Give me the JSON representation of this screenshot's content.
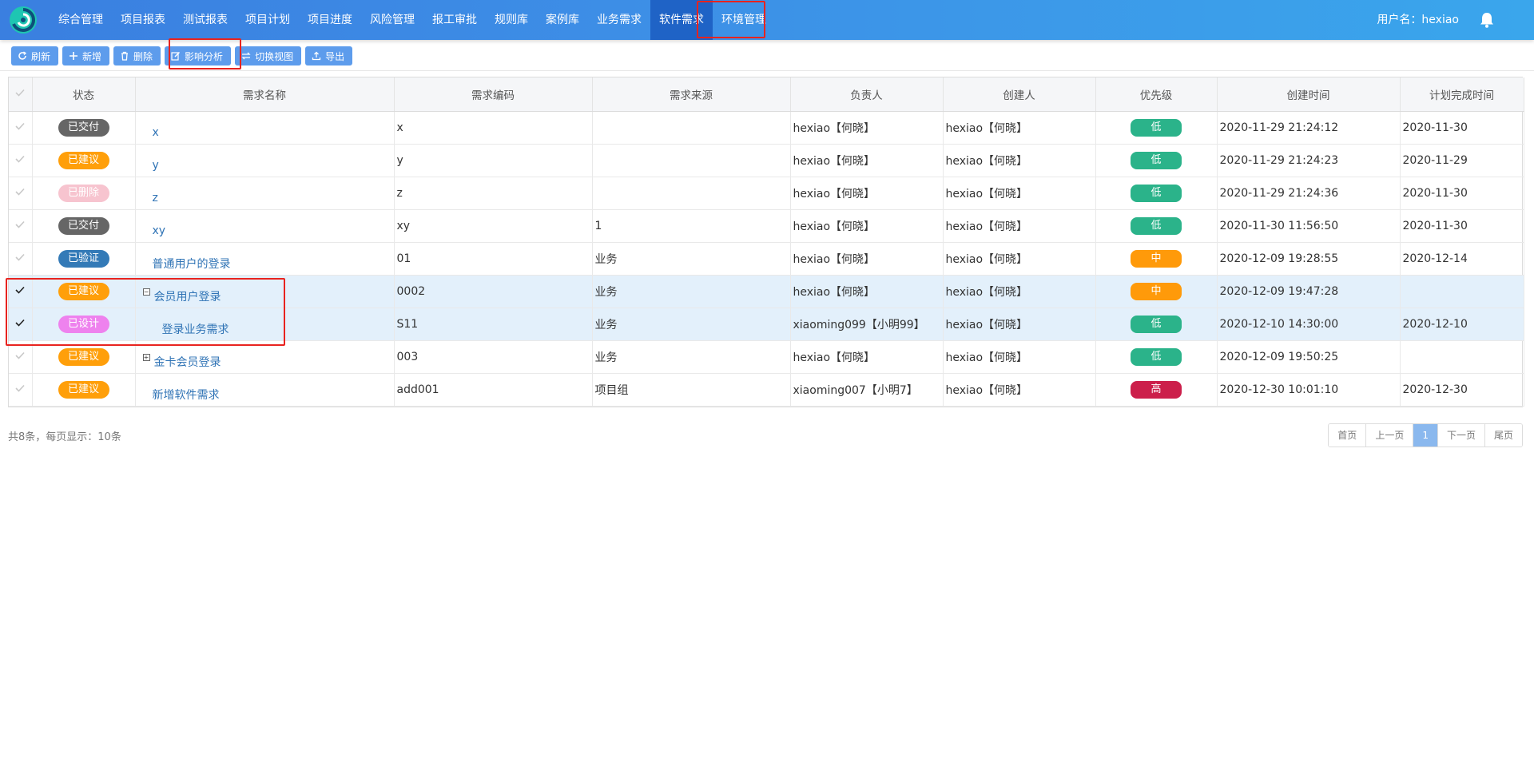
{
  "nav": {
    "items": [
      "综合管理",
      "项目报表",
      "测试报表",
      "项目计划",
      "项目进度",
      "风险管理",
      "报工审批",
      "规则库",
      "案例库",
      "业务需求",
      "软件需求",
      "环境管理"
    ],
    "active_index": 10,
    "user_label": "用户名：hexiao",
    "logo_icon": "swirl-logo-icon",
    "bell_icon": "bell-icon"
  },
  "toolbar": {
    "refresh": "刷新",
    "add": "新增",
    "delete": "删除",
    "impact": "影响分析",
    "switch_view": "切换视图",
    "export": "导出"
  },
  "table": {
    "headers": {
      "status": "状态",
      "name": "需求名称",
      "code": "需求编码",
      "source": "需求来源",
      "owner": "负责人",
      "creator": "创建人",
      "priority": "优先级",
      "created": "创建时间",
      "due": "计划完成时间"
    },
    "rows": [
      {
        "status": "已交付",
        "name": "x",
        "code": "x",
        "source": "",
        "owner": "hexiao【何晓】",
        "creator": "hexiao【何晓】",
        "priority": "低",
        "created": "2020-11-29 21:24:12",
        "due": "2020-11-30"
      },
      {
        "status": "已建议",
        "name": "y",
        "code": "y",
        "source": "",
        "owner": "hexiao【何晓】",
        "creator": "hexiao【何晓】",
        "priority": "低",
        "created": "2020-11-29 21:24:23",
        "due": "2020-11-29"
      },
      {
        "status": "已删除",
        "name": "z",
        "code": "z",
        "source": "",
        "owner": "hexiao【何晓】",
        "creator": "hexiao【何晓】",
        "priority": "低",
        "created": "2020-11-29 21:24:36",
        "due": "2020-11-30"
      },
      {
        "status": "已交付",
        "name": "xy",
        "code": "xy",
        "source": "1",
        "owner": "hexiao【何晓】",
        "creator": "hexiao【何晓】",
        "priority": "低",
        "created": "2020-11-30 11:56:50",
        "due": "2020-11-30"
      },
      {
        "status": "已验证",
        "name": "普通用户的登录",
        "code": "01",
        "source": "业务",
        "owner": "hexiao【何晓】",
        "creator": "hexiao【何晓】",
        "priority": "中",
        "created": "2020-12-09 19:28:55",
        "due": "2020-12-14"
      },
      {
        "status": "已建议",
        "name": "会员用户登录",
        "code": "0002",
        "source": "业务",
        "owner": "hexiao【何晓】",
        "creator": "hexiao【何晓】",
        "priority": "中",
        "created": "2020-12-09 19:47:28",
        "due": ""
      },
      {
        "status": "已设计",
        "name": "登录业务需求",
        "code": "S11",
        "source": "业务",
        "owner": "xiaoming099【小明99】",
        "creator": "hexiao【何晓】",
        "priority": "低",
        "created": "2020-12-10 14:30:00",
        "due": "2020-12-10"
      },
      {
        "status": "已建议",
        "name": "金卡会员登录",
        "code": "003",
        "source": "业务",
        "owner": "hexiao【何晓】",
        "creator": "hexiao【何晓】",
        "priority": "低",
        "created": "2020-12-09 19:50:25",
        "due": ""
      },
      {
        "status": "已建议",
        "name": "新增软件需求",
        "code": "add001",
        "source": "项目组",
        "owner": "xiaoming007【小明7】",
        "creator": "hexiao【何晓】",
        "priority": "高",
        "created": "2020-12-30 10:01:10",
        "due": "2020-12-30"
      }
    ]
  },
  "footer": {
    "summary": "共8条，每页显示：10条",
    "pager": {
      "first": "首页",
      "prev": "上一页",
      "current": "1",
      "next": "下一页",
      "last": "尾页"
    }
  },
  "colors": {
    "status": {
      "已交付": "#666666",
      "已建议": "#ff9f0a",
      "已删除": "#f7c4cf",
      "已验证": "#337ab7",
      "已设计": "#ee82ee"
    },
    "priority": {
      "低": "#2bb38a",
      "中": "#ff9a0a",
      "高": "#cc1f4b"
    },
    "accent": "#3d8ee6",
    "highlight_box": "#e8231f"
  }
}
